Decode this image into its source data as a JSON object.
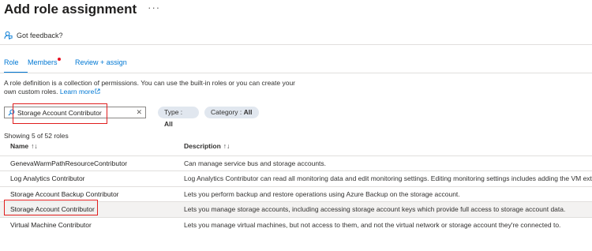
{
  "page": {
    "title": "Add role assignment",
    "more_label": "···"
  },
  "feedback": {
    "label": "Got feedback?"
  },
  "tabs": [
    {
      "label": "Role",
      "active": true,
      "dot": false
    },
    {
      "label": "Members",
      "active": false,
      "dot": true
    },
    {
      "label": "Review + assign",
      "active": false,
      "dot": false
    }
  ],
  "description": {
    "text": "A role definition is a collection of permissions. You can use the built-in roles or you can create your own custom roles.",
    "link": "Learn more"
  },
  "search": {
    "value": "Storage Account Contributor",
    "clear_label": "✕"
  },
  "filters": {
    "type_label": "Type : ",
    "type_value": "All",
    "category_label": "Category : ",
    "category_value": "All"
  },
  "showing": "Showing 5 of 52 roles",
  "table": {
    "columns": [
      "Name",
      "Description"
    ],
    "sort_glyph": "↑↓",
    "rows": [
      {
        "name": "GenevaWarmPathResourceContributor",
        "description": "Can manage service bus and storage accounts."
      },
      {
        "name": "Log Analytics Contributor",
        "description": "Log Analytics Contributor can read all monitoring data and edit monitoring settings. Editing monitoring settings includes adding the VM extension to VMs; readi"
      },
      {
        "name": "Storage Account Backup Contributor",
        "description": "Lets you perform backup and restore operations using Azure Backup on the storage account."
      },
      {
        "name": "Storage Account Contributor",
        "description": "Lets you manage storage accounts, including accessing storage account keys which provide full access to storage account data.",
        "selected": true
      },
      {
        "name": "Virtual Machine Contributor",
        "description": "Lets you manage virtual machines, but not access to them, and not the virtual network or storage account they're connected to."
      }
    ]
  },
  "colors": {
    "accent": "#0078d4",
    "highlight_box": "#e01e1e",
    "pill_bg": "#e1e7ef",
    "selected_row": "#f3f2f1"
  }
}
